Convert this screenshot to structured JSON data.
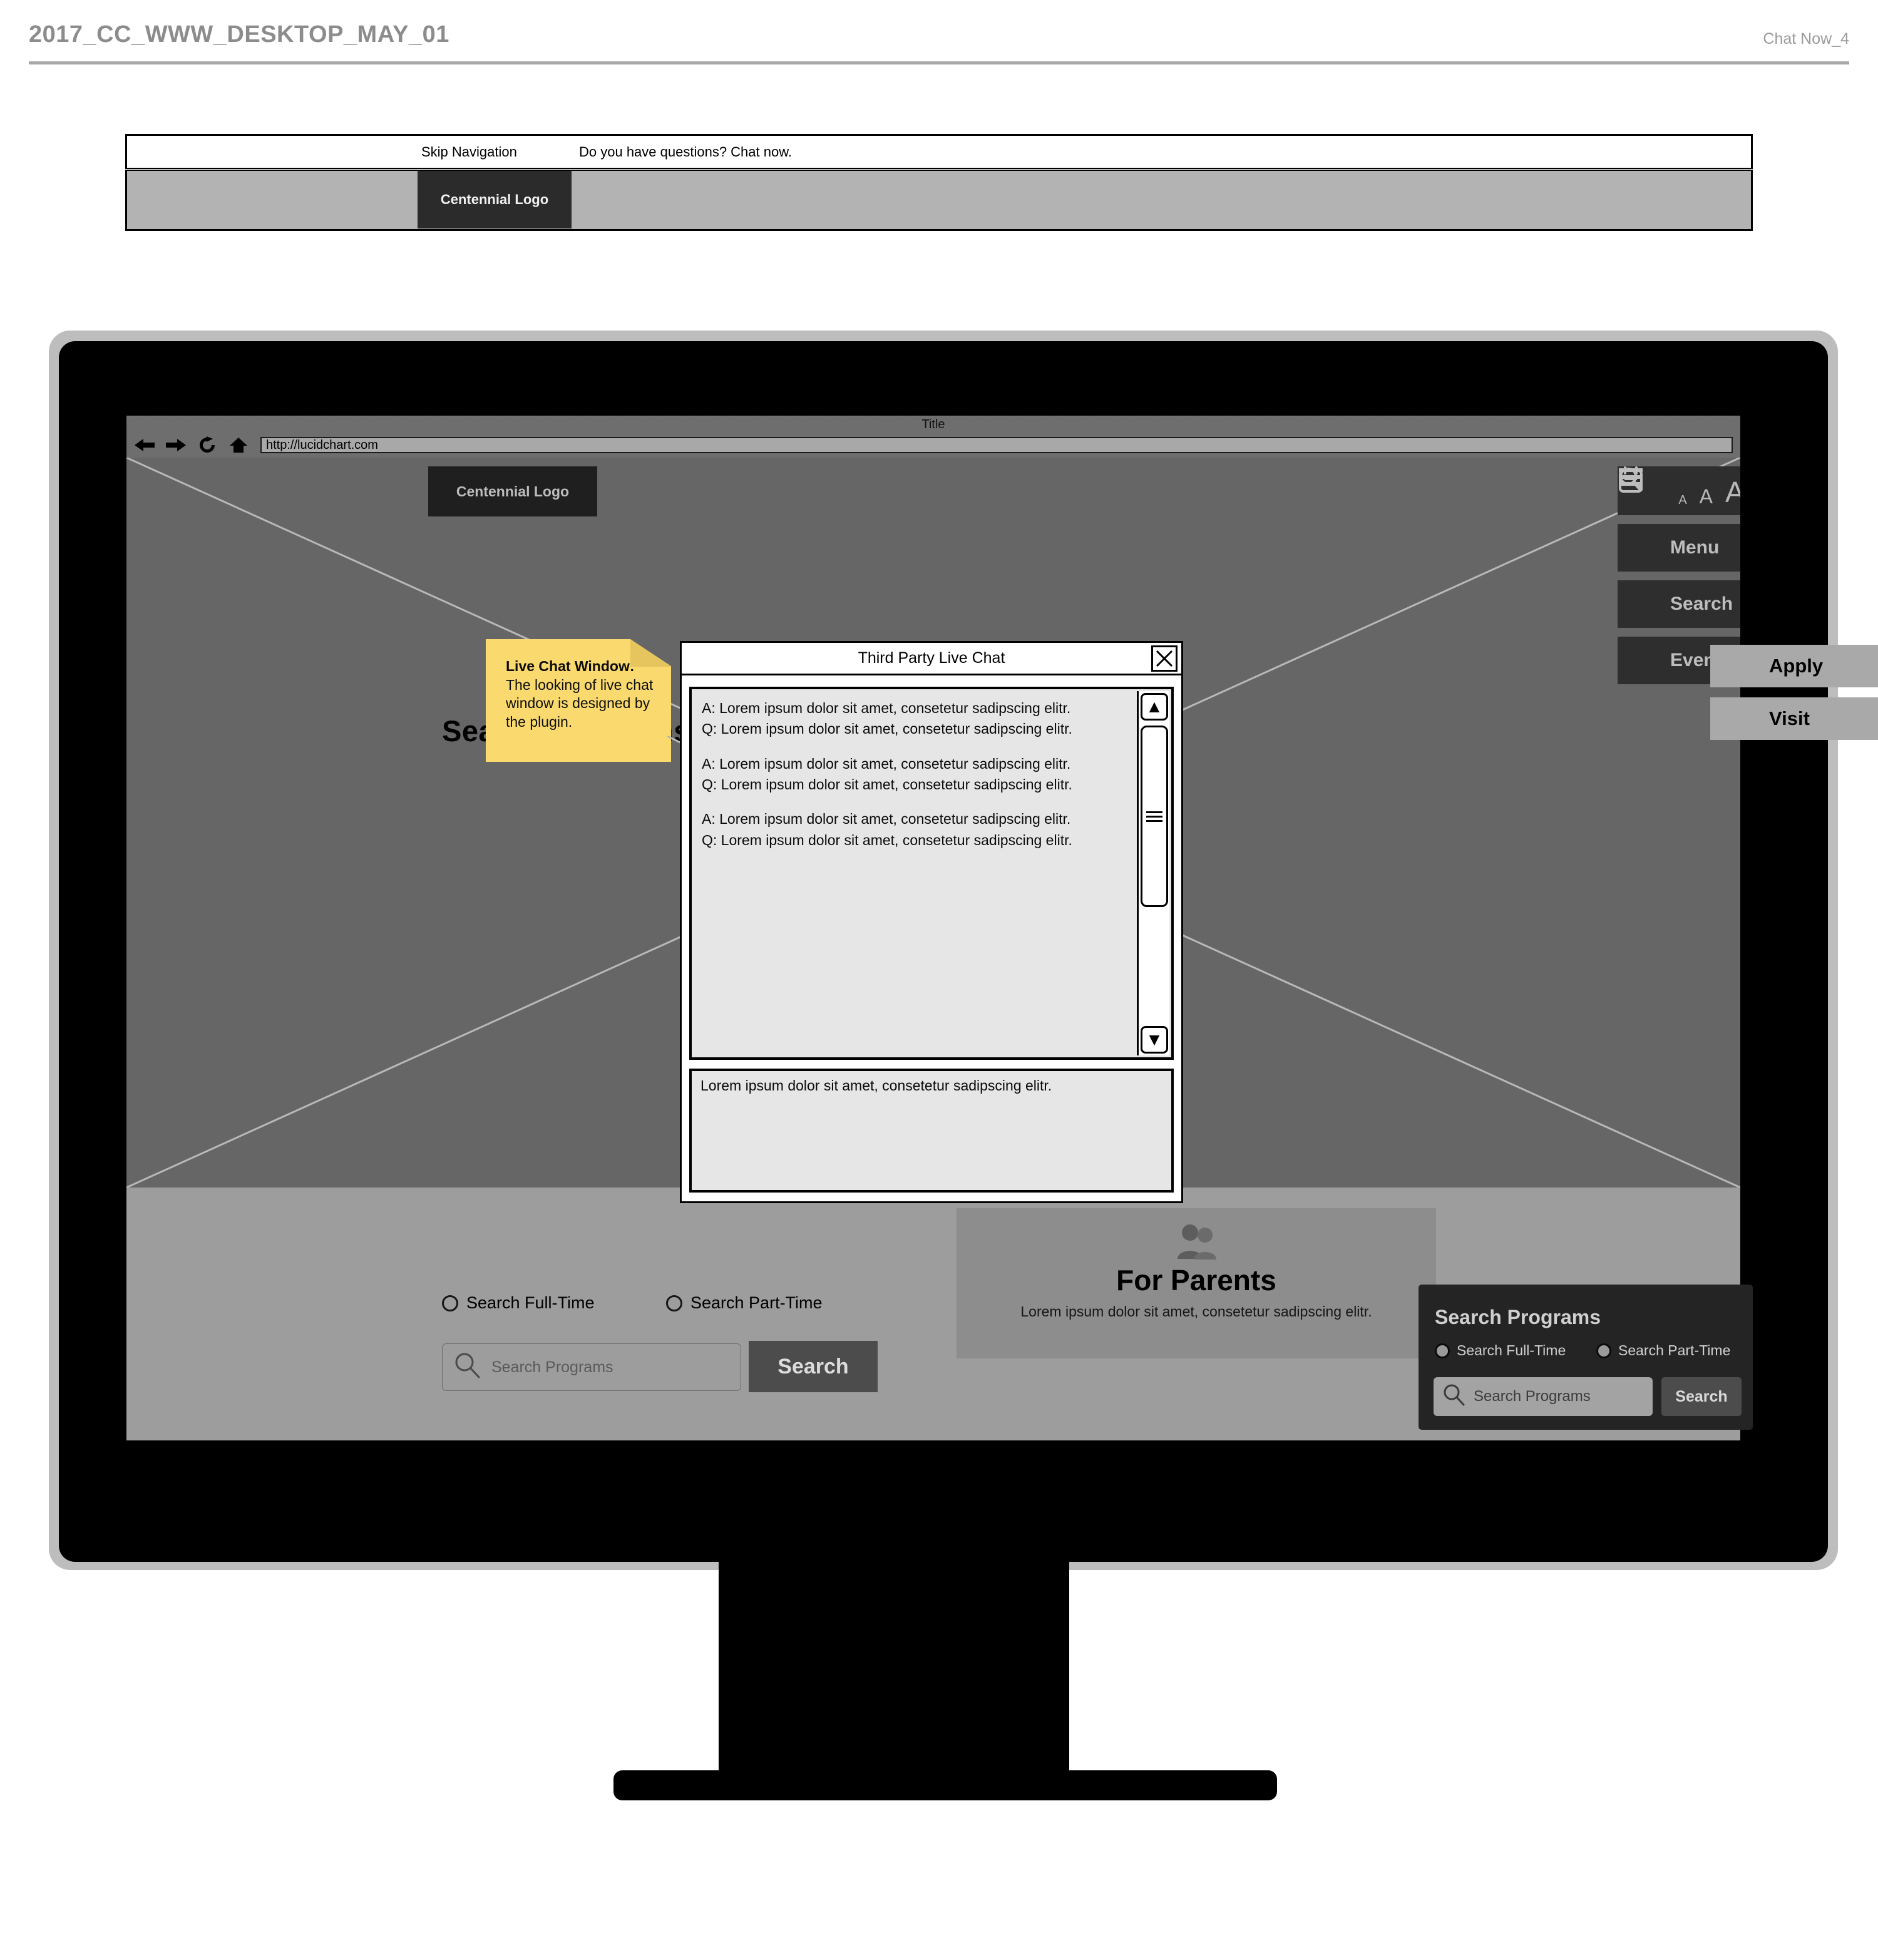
{
  "document_header": {
    "title": "2017_CC_WWW_DESKTOP_MAY_01",
    "right_label": "Chat Now_4"
  },
  "top_nav_wireframe": {
    "skip_navigation": "Skip Navigation",
    "chat_prompt": "Do you have questions? Chat now.",
    "logo_label": "Centennial Logo"
  },
  "browser": {
    "window_title": "Title",
    "url": "http://lucidchart.com",
    "icons": {
      "back": "back-arrow-icon",
      "forward": "forward-arrow-icon",
      "reload": "reload-icon",
      "home": "home-icon"
    }
  },
  "page": {
    "logo_label": "Centennial Logo",
    "font_sizer": {
      "small": "A",
      "medium": "A",
      "large": "A"
    },
    "rail_items": [
      {
        "label": "Menu",
        "icon": "hamburger-menu-icon"
      },
      {
        "label": "Search",
        "icon": "search-icon"
      },
      {
        "label": "Events",
        "icon": "calendar-icon"
      }
    ],
    "cta_buttons": [
      {
        "label": "Apply"
      },
      {
        "label": "Visit"
      }
    ],
    "search_programs": {
      "heading": "Search  Programs",
      "radio_full_time": "Search Full-Time",
      "radio_part_time": "Search Part-Time",
      "input_placeholder": "Search Programs",
      "button_label": "Search"
    },
    "for_parents": {
      "icon": "people-icon",
      "title": "For Parents",
      "subtitle": "Lorem ipsum dolor sit amet, consetetur sadipscing elitr."
    },
    "dark_search_panel": {
      "heading": "Search  Programs",
      "radio_full_time": "Search Full-Time",
      "radio_part_time": "Search Part-Time",
      "input_placeholder": "Search Programs",
      "button_label": "Search"
    }
  },
  "sticky_note": {
    "title": "Live Chat Window:",
    "body": "The looking of live chat window is designed by the plugin."
  },
  "chat_dialog": {
    "title": "Third Party Live Chat",
    "close_glyph": "✕",
    "messages": [
      {
        "a": "A: Lorem ipsum dolor sit amet, consetetur sadipscing elitr.",
        "q": "Q: Lorem ipsum dolor sit amet, consetetur sadipscing elitr."
      },
      {
        "a": "A: Lorem ipsum dolor sit amet, consetetur sadipscing elitr.",
        "q": "Q: Lorem ipsum dolor sit amet, consetetur sadipscing elitr."
      },
      {
        "a": "A: Lorem ipsum dolor sit amet, consetetur sadipscing elitr.",
        "q": "Q: Lorem ipsum dolor sit amet, consetetur sadipscing elitr."
      }
    ],
    "input_text": "Lorem ipsum dolor sit amet, consetetur sadipscing elitr.",
    "scrollbar": {
      "up_glyph": "▲",
      "down_glyph": "▼"
    }
  },
  "colors": {
    "note_yellow": "#fada6e",
    "hero_gray": "#666666",
    "band_gray": "#9d9d9d",
    "dark_panel": "#242424"
  }
}
